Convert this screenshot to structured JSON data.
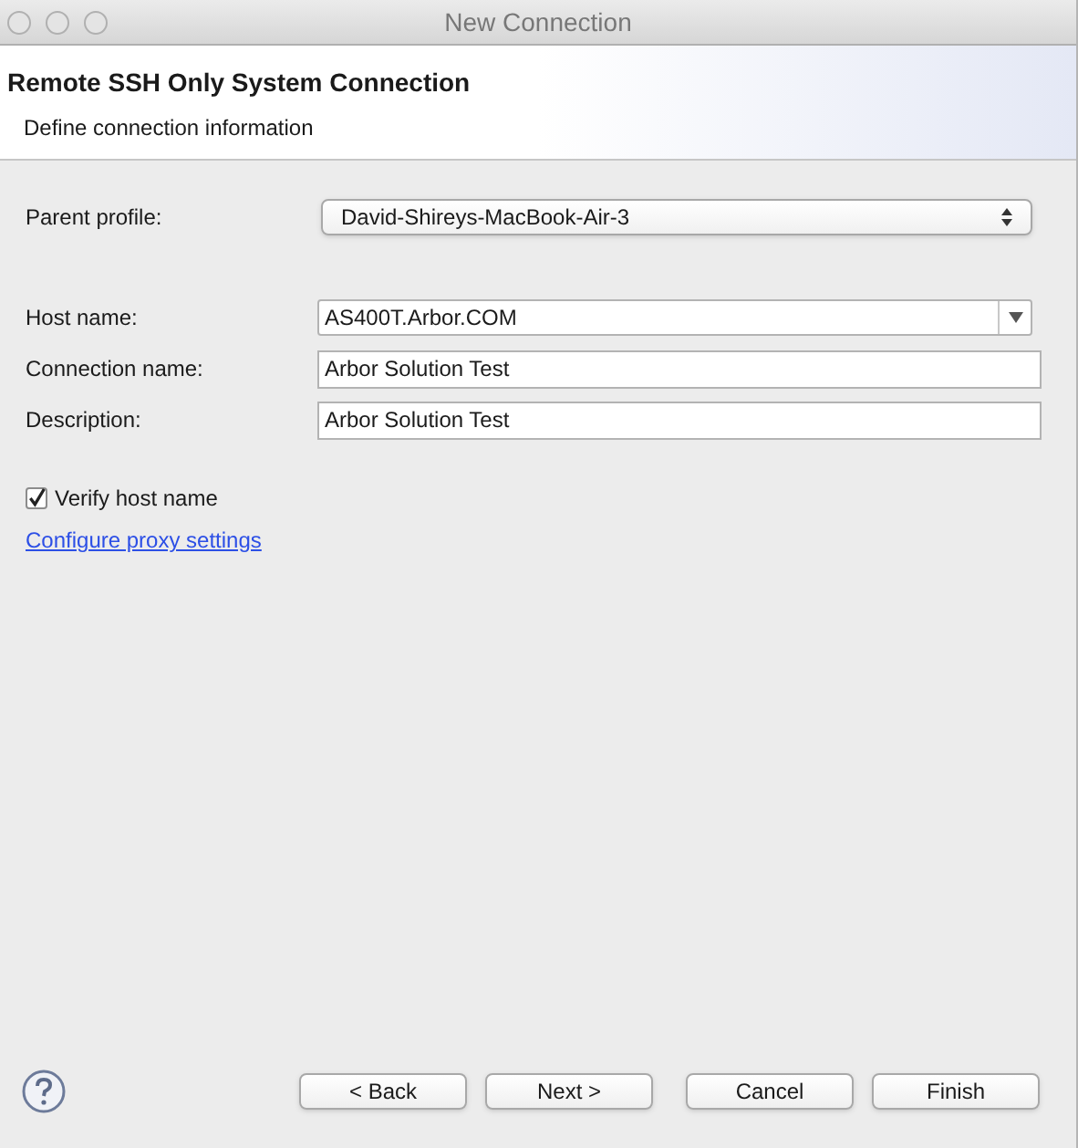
{
  "window": {
    "title": "New Connection"
  },
  "header": {
    "title": "Remote SSH Only System Connection",
    "subtitle": "Define connection information"
  },
  "parent_profile": {
    "label": "Parent profile:",
    "value": "David-Shireys-MacBook-Air-3"
  },
  "fields": [
    {
      "kind": "combo",
      "label": "Host name:",
      "value": "AS400T.Arbor.COM"
    },
    {
      "kind": "text",
      "label": "Connection name:",
      "value": "Arbor Solution Test"
    },
    {
      "kind": "text",
      "label": "Description:",
      "value": "Arbor Solution Test"
    }
  ],
  "verify_host": {
    "label": "Verify host name",
    "checked": true
  },
  "proxy_link": "Configure proxy settings",
  "buttons": [
    "< Back",
    "Next >",
    "Cancel",
    "Finish"
  ]
}
